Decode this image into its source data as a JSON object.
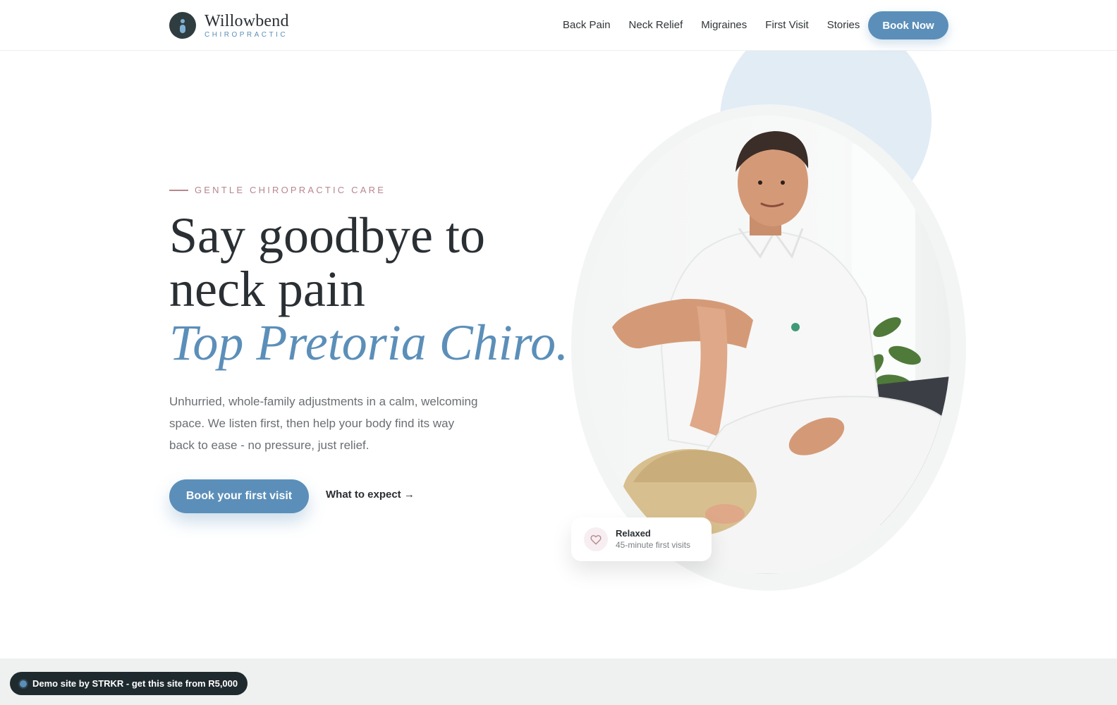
{
  "brand": {
    "name": "Willowbend",
    "tagline": "CHIROPRACTIC"
  },
  "nav": {
    "links": [
      "Back Pain",
      "Neck Relief",
      "Migraines",
      "First Visit",
      "Stories"
    ],
    "cta": "Book Now"
  },
  "hero": {
    "eyebrow": "GENTLE CHIROPRACTIC CARE",
    "headline_line1": "Say goodbye to",
    "headline_line2": "neck pain",
    "headline_accent": "Top Pretoria Chiro.",
    "lede": "Unhurried, whole-family adjustments in a calm, welcoming space. We listen first, then help your body find its way back to ease - no pressure, just relief.",
    "primary_cta": "Book your first visit",
    "secondary_cta": "What to expect →"
  },
  "badge": {
    "title": "Relaxed",
    "subtitle": "45-minute first visits",
    "icon": "heart-icon"
  },
  "demo_banner": {
    "text": "Demo site by STRKR - get this site from R5,000"
  },
  "colors": {
    "accent": "#5b8fb9",
    "rose": "#b7868f",
    "text": "#2a2f33",
    "muted": "#6a6f73"
  }
}
